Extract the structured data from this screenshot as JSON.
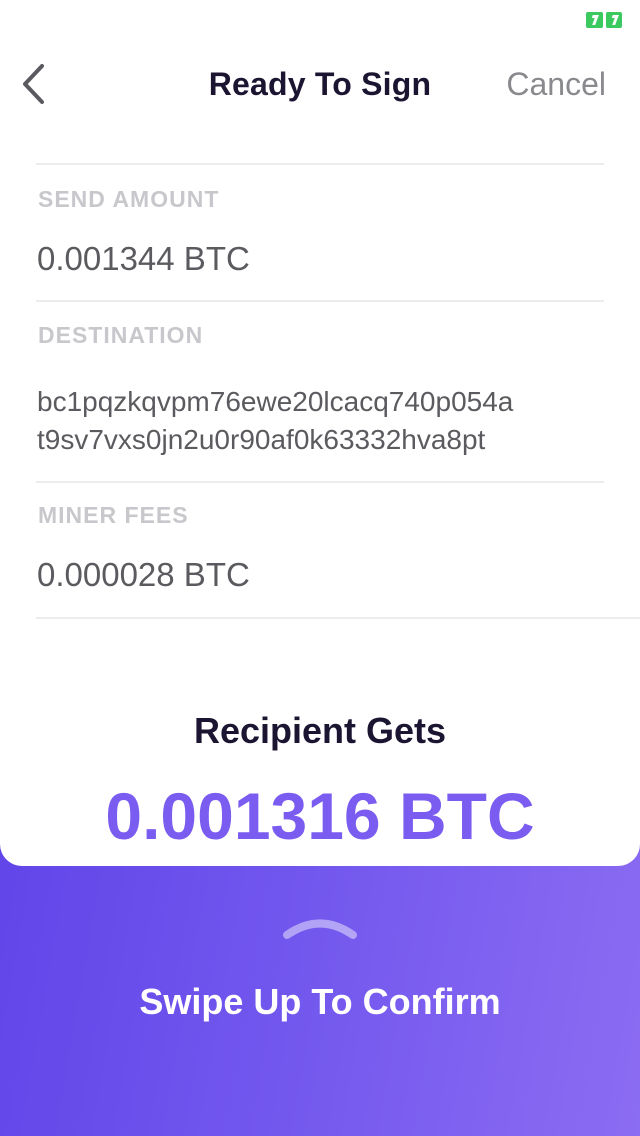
{
  "nav": {
    "title": "Ready To Sign",
    "cancel_label": "Cancel"
  },
  "send_amount": {
    "label": "SEND AMOUNT",
    "value": "0.001344 BTC"
  },
  "destination": {
    "label": "DESTINATION",
    "line1": "bc1pqzkqvpm76ewe20lcacq740p054a",
    "line2": "t9sv7vxs0jn2u0r90af0k63332hva8pt"
  },
  "miner_fees": {
    "label": "MINER FEES",
    "value": "0.000028 BTC"
  },
  "recipient": {
    "title": "Recipient Gets",
    "amount": "0.001316 BTC"
  },
  "swipe": {
    "label": "Swipe Up To Confirm"
  },
  "colors": {
    "accent": "#7a5cf0",
    "gradient_start": "#5a3de6",
    "gradient_end": "#8b6cf2",
    "battery": "#3cc960"
  },
  "icons": {
    "back": "chevron-left-icon",
    "swipe": "chevron-up-icon",
    "battery": "battery-charging-icon"
  }
}
